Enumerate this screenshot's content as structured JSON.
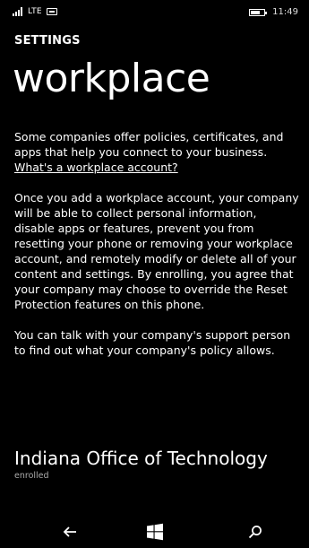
{
  "status_bar": {
    "network": "LTE",
    "time": "11:49",
    "battery_level": 0.7,
    "icons": [
      "signal-icon",
      "sim-icon",
      "battery-icon"
    ]
  },
  "header": {
    "section": "SETTINGS",
    "title": "workplace"
  },
  "body": {
    "intro": "Some companies offer policies, certificates, and apps that help you connect to your business.",
    "link_label": "What's a workplace account?",
    "paragraph_2": "Once you add a workplace account, your company will be able to collect personal information, disable apps or features, prevent you from resetting your phone or removing your workplace account, and remotely modify or delete all of your content and settings. By enrolling, you agree that your company may choose to override the Reset Protection features on this phone.",
    "paragraph_3": "You can talk with your company's support person to find out what your company's policy allows."
  },
  "account": {
    "name": "Indiana Office of Technology",
    "status": "enrolled"
  },
  "nav": {
    "icons": [
      "back-arrow-icon",
      "windows-start-icon",
      "search-icon"
    ]
  }
}
